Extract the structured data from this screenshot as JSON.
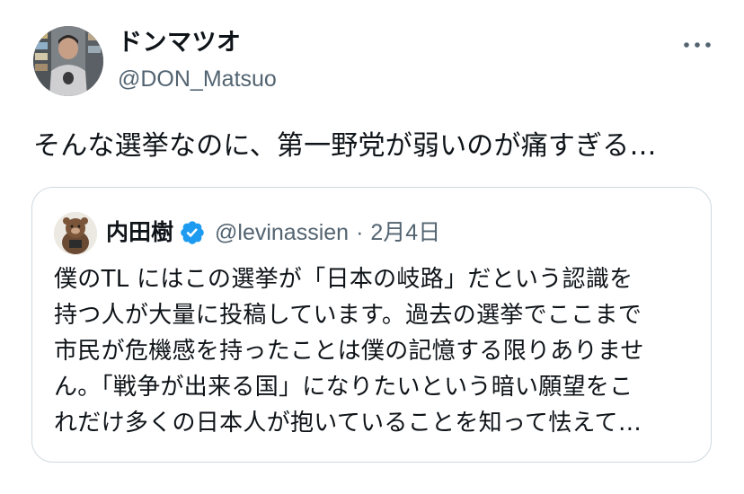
{
  "tweet": {
    "author": {
      "display_name": "ドンマツオ",
      "handle": "@DON_Matsuo"
    },
    "more_icon": "more-horizontal-icon",
    "text": "そんな選挙なのに、第一野党が弱いのが痛すぎる…"
  },
  "quote": {
    "author": {
      "display_name": "内田樹",
      "handle": "@levinassien",
      "verified": true,
      "verified_icon": "verified-badge-icon"
    },
    "separator": "·",
    "date": "2月4日",
    "lines": [
      "僕のTL にはこの選挙が「日本の岐路」だという認識を",
      "持つ人が大量に投稿しています。過去の選挙でここまで",
      "市民が危機感を持ったことは僕の記憶する限りありませ",
      "ん。「戦争が出来る国」になりたいという暗い願望をこ",
      "れだけ多くの日本人が抱いていることを知って怯えて…"
    ]
  },
  "colors": {
    "text": "#0f1419",
    "secondary": "#536471",
    "border": "#cfd9de",
    "verified": "#1d9bf0"
  }
}
